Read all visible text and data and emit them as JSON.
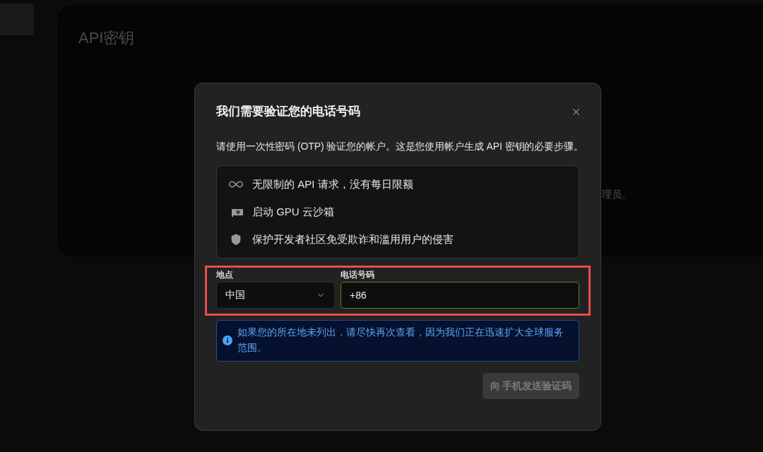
{
  "background_card": {
    "title": "API密钥",
    "text_fragment": "理员。"
  },
  "dialog": {
    "title": "我们需要验证您的电话号码",
    "description": "请使用一次性密码 (OTP) 验证您的帐户。这是您使用帐户生成 API 密钥的必要步骤。",
    "features": [
      {
        "text": "无限制的 API 请求，没有每日限额"
      },
      {
        "text": "启动 GPU 云沙箱"
      },
      {
        "text": "保护开发者社区免受欺诈和滥用用户的侵害"
      }
    ],
    "fields_highlighted": true,
    "location": {
      "label": "地点",
      "value": "中国"
    },
    "phone": {
      "label": "电话号码",
      "value": "+86",
      "focused": true
    },
    "notice": {
      "text": "如果您的所在地未列出，请尽快再次查看，因为我们正在迅速扩大全球服务范围。"
    },
    "send_button": {
      "label": "向 手机发送验证码",
      "disabled": true
    }
  }
}
